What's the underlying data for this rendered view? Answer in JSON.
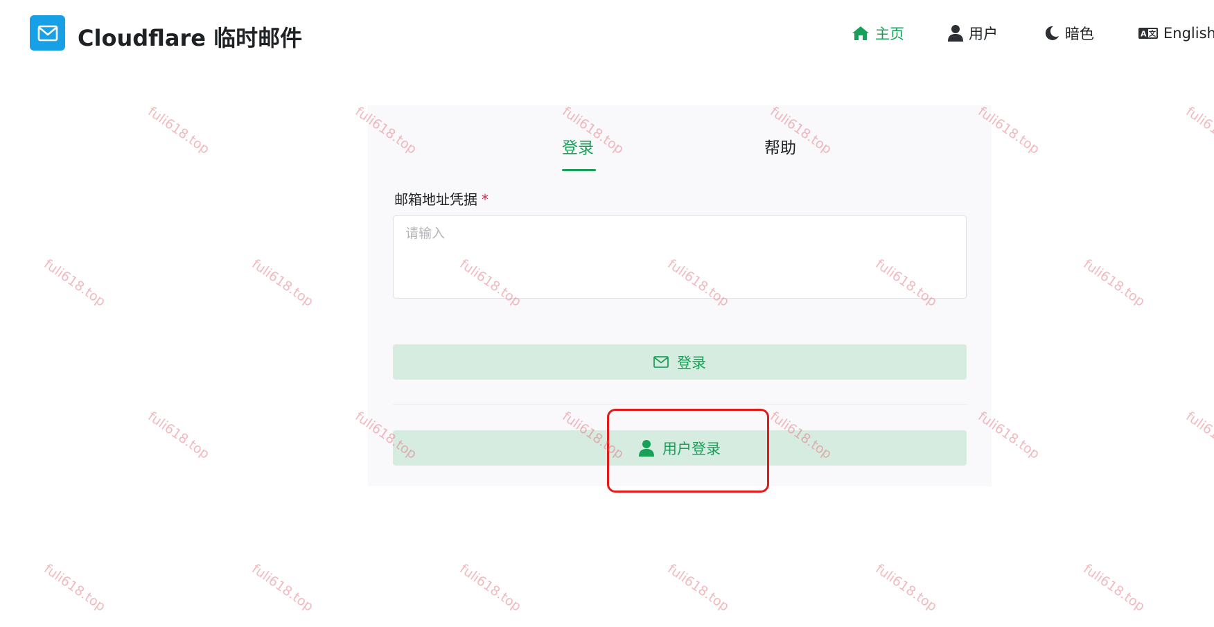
{
  "header": {
    "app_title": "Cloudflare 临时邮件",
    "nav": {
      "home": "主页",
      "user": "用户",
      "dark": "暗色",
      "lang": "English"
    }
  },
  "tabs": {
    "login": "登录",
    "help": "帮助"
  },
  "form": {
    "field_label": "邮箱地址凭据",
    "required_mark": "*",
    "placeholder": "请输入",
    "value": ""
  },
  "buttons": {
    "login": "登录",
    "user_login": "用户登录"
  },
  "watermark": "fuli618.top",
  "colors": {
    "accent": "#18a058",
    "logo": "#18a0e6",
    "annotation": "#e41a1a",
    "required": "#d03050"
  },
  "icons": {
    "logo": "mail-icon",
    "home": "home-icon",
    "user": "user-icon",
    "dark": "moon-icon",
    "lang": "translate-icon",
    "login_button": "mail-icon",
    "user_login_button": "user-icon"
  }
}
